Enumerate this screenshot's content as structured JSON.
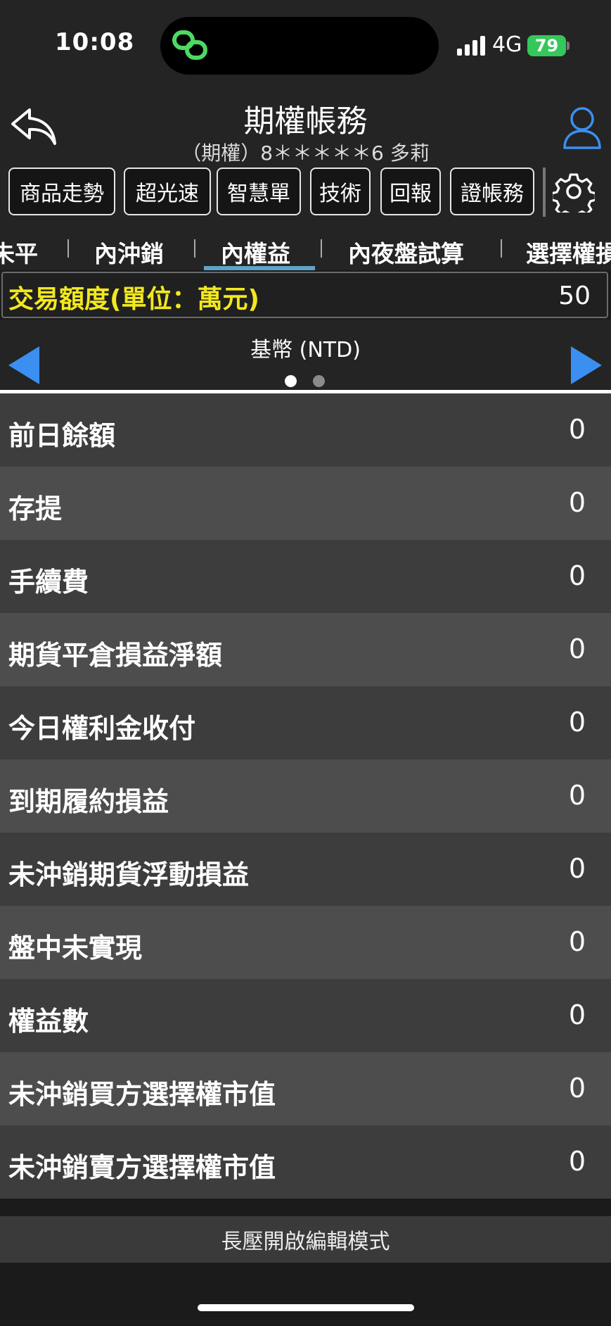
{
  "status_bar": {
    "time": "10:08",
    "network": "4G",
    "battery": "79"
  },
  "header": {
    "title": "期權帳務",
    "subtitle": "（期權）8＊＊＊＊＊6 多莉"
  },
  "toolbar": {
    "buttons": [
      "商品走勢",
      "超光速",
      "智慧單",
      "技術",
      "回報",
      "證帳務"
    ]
  },
  "tabs": [
    "未平",
    "內沖銷",
    "內權益",
    "內夜盤試算",
    "選擇權損"
  ],
  "active_tab": "內權益",
  "quota": {
    "label": "交易額度(單位：萬元)",
    "value": "50"
  },
  "pager": {
    "currency": "基幣 (NTD)",
    "pages": 2,
    "current_page": 1
  },
  "rows": [
    {
      "label": "前日餘額",
      "value": "0"
    },
    {
      "label": "存提",
      "value": "0"
    },
    {
      "label": "手續費",
      "value": "0"
    },
    {
      "label": "期貨平倉損益淨額",
      "value": "0"
    },
    {
      "label": "今日權利金收付",
      "value": "0"
    },
    {
      "label": "到期履約損益",
      "value": "0"
    },
    {
      "label": "未沖銷期貨浮動損益",
      "value": "0"
    },
    {
      "label": "盤中未實現",
      "value": "0"
    },
    {
      "label": "權益數",
      "value": "0"
    },
    {
      "label": "未沖銷買方選擇權市值",
      "value": "0"
    },
    {
      "label": "未沖銷賣方選擇權市值",
      "value": "0"
    }
  ],
  "footer": {
    "edit_hint": "長壓開啟編輯模式"
  },
  "colors": {
    "accent_blue": "#3b8ff0",
    "quota_yellow": "#f2e81d",
    "battery_green": "#35c759",
    "tab_underline": "#5ea3c8"
  }
}
